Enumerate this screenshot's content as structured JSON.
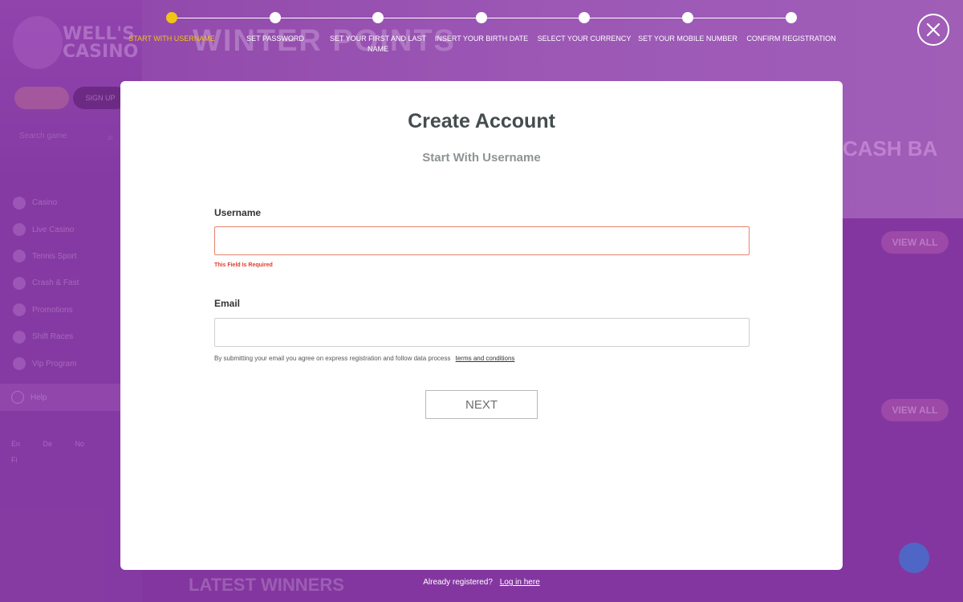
{
  "background": {
    "logo_text": "WELL'S CASINO",
    "signup_label": "SIGN UP",
    "search_placeholder": "Search game",
    "nav_items": [
      "Casino",
      "Live Casino",
      "Tennis Sport",
      "Crash & Fast",
      "Promotions",
      "Shift Races",
      "Vip Program"
    ],
    "help_label": "Help",
    "languages": [
      "En",
      "De",
      "No",
      "Fi"
    ],
    "banner_title": "WINTER POINTS",
    "banner_right": "CASH BA",
    "view_all_label": "VIEW ALL",
    "latest_winners": "LATEST WINNERS"
  },
  "stepper": {
    "steps": [
      "START WITH USERNAME",
      "SET PASSWORD",
      "SET YOUR FIRST AND LAST NAME",
      "INSERT YOUR BIRTH DATE",
      "SELECT YOUR CURRENCY",
      "SET YOUR MOBILE NUMBER",
      "CONFIRM REGISTRATION"
    ],
    "active_step": 0,
    "active_color": "#f2c417"
  },
  "modal": {
    "title": "Create Account",
    "subtitle": "Start With Username",
    "username_label": "Username",
    "username_value": "",
    "username_error": "This Field Is Required",
    "email_label": "Email",
    "email_value": "",
    "terms_note": "By submitting your email you agree on express registration and follow data process",
    "terms_link": "terms and conditions",
    "next_label": "NEXT"
  },
  "footer": {
    "already_text": "Already registered?",
    "login_link": "Log in here"
  }
}
